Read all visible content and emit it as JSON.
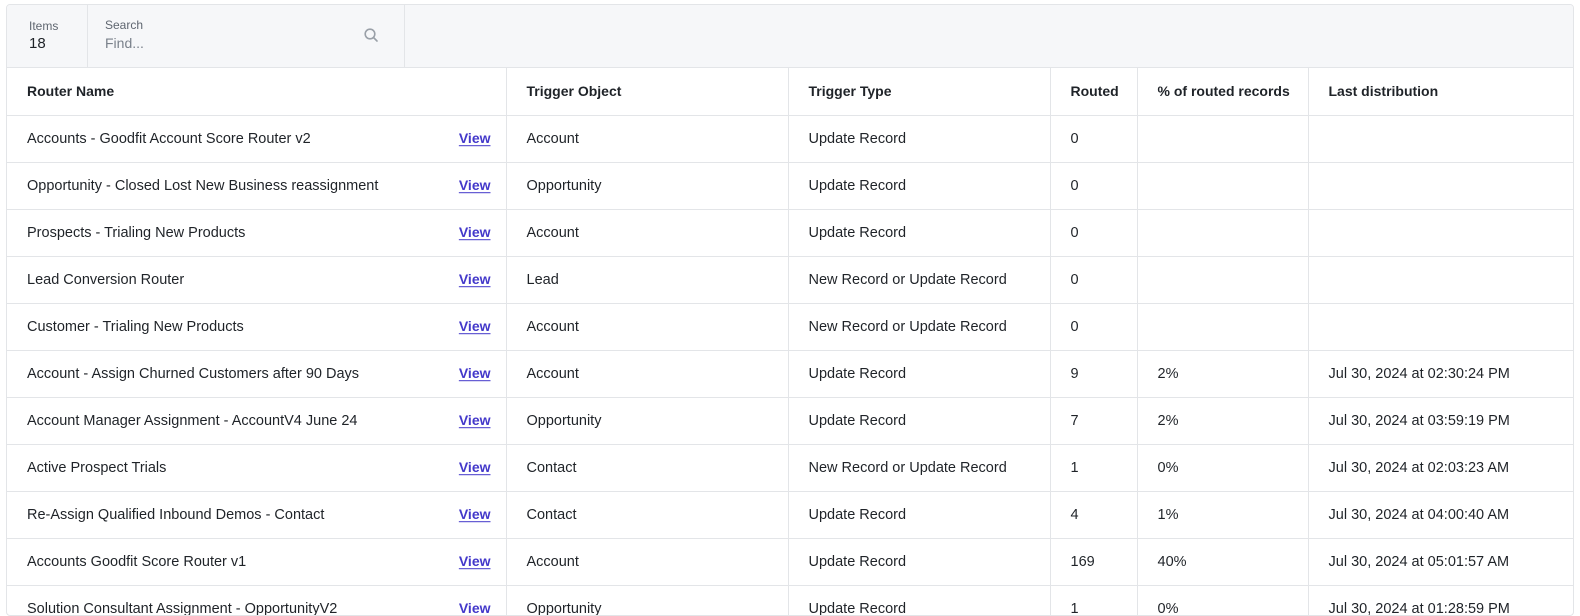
{
  "toolbar": {
    "items_label": "Items",
    "items_count": "18",
    "search_label": "Search",
    "search_placeholder": "Find...",
    "search_icon": "search-icon"
  },
  "table": {
    "columns": [
      "Router Name",
      "Trigger Object",
      "Trigger Type",
      "Routed",
      "% of routed records",
      "Last distribution"
    ],
    "view_label": "View",
    "rows": [
      {
        "name": "Accounts - Goodfit Account Score Router v2",
        "object": "Account",
        "type": "Update Record",
        "routed": "0",
        "percent": "",
        "last": ""
      },
      {
        "name": "Opportunity - Closed Lost New Business reassignment",
        "object": "Opportunity",
        "type": "Update Record",
        "routed": "0",
        "percent": "",
        "last": ""
      },
      {
        "name": "Prospects - Trialing New Products",
        "object": "Account",
        "type": "Update Record",
        "routed": "0",
        "percent": "",
        "last": ""
      },
      {
        "name": "Lead Conversion Router",
        "object": "Lead",
        "type": "New Record or Update Record",
        "routed": "0",
        "percent": "",
        "last": ""
      },
      {
        "name": "Customer - Trialing New Products",
        "object": "Account",
        "type": "New Record or Update Record",
        "routed": "0",
        "percent": "",
        "last": ""
      },
      {
        "name": "Account - Assign Churned Customers after 90 Days",
        "object": "Account",
        "type": "Update Record",
        "routed": "9",
        "percent": "2%",
        "last": "Jul 30, 2024 at 02:30:24 PM"
      },
      {
        "name": "Account Manager Assignment - AccountV4 June 24",
        "object": "Opportunity",
        "type": "Update Record",
        "routed": "7",
        "percent": "2%",
        "last": "Jul 30, 2024 at 03:59:19 PM"
      },
      {
        "name": "Active Prospect Trials",
        "object": "Contact",
        "type": "New Record or Update Record",
        "routed": "1",
        "percent": "0%",
        "last": "Jul 30, 2024 at 02:03:23 AM"
      },
      {
        "name": "Re-Assign Qualified Inbound Demos - Contact",
        "object": "Contact",
        "type": "Update Record",
        "routed": "4",
        "percent": "1%",
        "last": "Jul 30, 2024 at 04:00:40 AM"
      },
      {
        "name": "Accounts Goodfit Score Router v1",
        "object": "Account",
        "type": "Update Record",
        "routed": "169",
        "percent": "40%",
        "last": "Jul 30, 2024 at 05:01:57 AM"
      },
      {
        "name": "Solution Consultant Assignment - OpportunityV2",
        "object": "Opportunity",
        "type": "Update Record",
        "routed": "1",
        "percent": "0%",
        "last": "Jul 30, 2024 at 01:28:59 PM"
      }
    ]
  }
}
